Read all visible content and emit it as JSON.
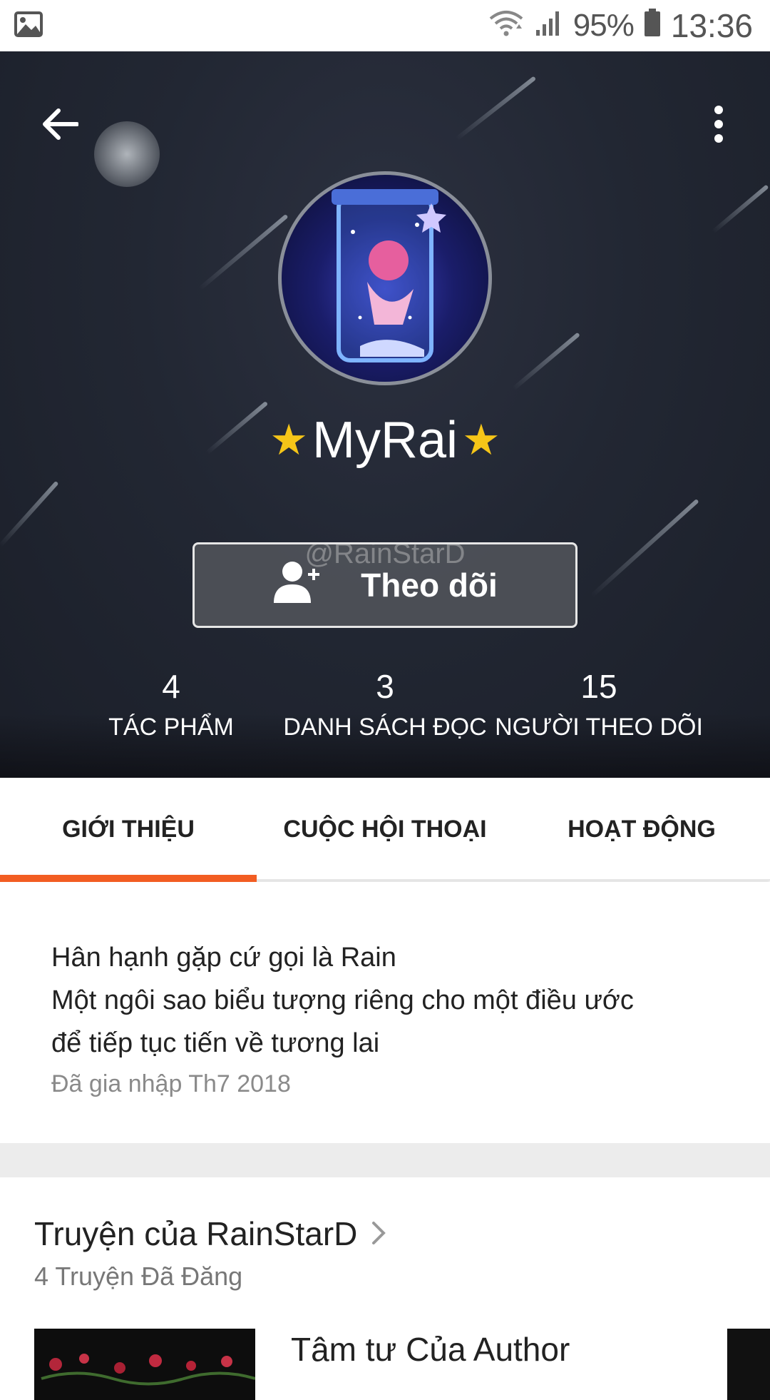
{
  "status_bar": {
    "battery_percent": "95%",
    "time": "13:36",
    "icons": [
      "gallery-notification-icon",
      "wifi-icon",
      "signal-icon",
      "battery-icon"
    ]
  },
  "header": {
    "back_icon": "arrow-left-icon",
    "more_icon": "more-vertical-icon",
    "display_name": "MyRai",
    "name_star": "★",
    "username": "@RainStarD",
    "follow_label": "Theo dõi",
    "stats": [
      {
        "value": "4",
        "label": "TÁC PHẨM"
      },
      {
        "value": "3",
        "label": "DANH SÁCH ĐỌC"
      },
      {
        "value": "15",
        "label": "NGƯỜI THEO DÕI"
      }
    ]
  },
  "tabs": [
    {
      "label": "GIỚI THIỆU",
      "active": true
    },
    {
      "label": "CUỘC HỘI THOẠI",
      "active": false
    },
    {
      "label": "HOẠT ĐỘNG",
      "active": false
    }
  ],
  "about": {
    "lines": [
      "Hân hạnh gặp cứ gọi là Rain",
      "Một ngôi sao biểu tượng riêng cho một điều ước",
      "để tiếp tục tiến về tương lai"
    ],
    "joined": "Đã gia nhập Th7 2018"
  },
  "stories": {
    "title": "Truyện của RainStarD",
    "count": "4 Truyện Đã Đăng",
    "items": [
      {
        "title": "Tâm tư Của Author"
      }
    ]
  },
  "colors": {
    "accent": "#f25d22",
    "star": "#f5c518"
  }
}
